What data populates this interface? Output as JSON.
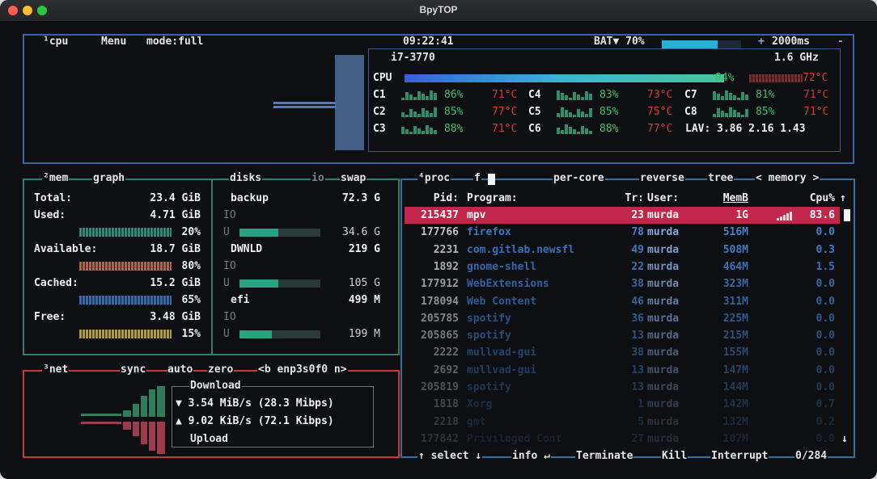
{
  "window": {
    "title": "BpyTOP"
  },
  "cpu": {
    "labels": {
      "cpu": "¹cpu",
      "menu": "Menu",
      "mode": "mode:full",
      "clock": "09:22:41",
      "battery": "BAT▼ 70%",
      "battery_pct": 70,
      "plus": "+",
      "interval": "2000ms",
      "minus": "-"
    },
    "model": "i7-3770",
    "freq": "1.6 GHz",
    "total": {
      "label": "CPU",
      "pct": "84%",
      "pct_value": 84,
      "temp": "72°C"
    },
    "cores": [
      {
        "name": "C1",
        "pct": "86%",
        "temp": "71°C"
      },
      {
        "name": "C2",
        "pct": "85%",
        "temp": "77°C"
      },
      {
        "name": "C3",
        "pct": "88%",
        "temp": "71°C"
      },
      {
        "name": "C4",
        "pct": "83%",
        "temp": "73°C"
      },
      {
        "name": "C5",
        "pct": "85%",
        "temp": "75°C"
      },
      {
        "name": "C6",
        "pct": "88%",
        "temp": "77°C"
      },
      {
        "name": "C7",
        "pct": "81%",
        "temp": "71°C"
      },
      {
        "name": "C8",
        "pct": "85%",
        "temp": "71°C"
      }
    ],
    "lav_label": "LAV:",
    "load_avg": "3.86 2.16 1.43"
  },
  "mem": {
    "labels": {
      "mem": "²mem",
      "graph": "graph"
    },
    "rows": [
      {
        "label": "Total:",
        "value": "23.4 GiB"
      },
      {
        "label": "Used:",
        "value": "4.71 GiB",
        "pct": "20%"
      },
      {
        "label": "Available:",
        "value": "18.7 GiB",
        "pct": "80%"
      },
      {
        "label": "Cached:",
        "value": "15.2 GiB",
        "pct": "65%"
      },
      {
        "label": "Free:",
        "value": "3.48 GiB",
        "pct": "15%"
      }
    ]
  },
  "disks": {
    "labels": {
      "disks": "disks",
      "io": "io",
      "swap": "swap"
    },
    "items": [
      {
        "name": "backup",
        "size": "72.3 G",
        "io": "IO",
        "u": "U",
        "used": "34.6 G",
        "used_pct": 48
      },
      {
        "name": "DWNLD",
        "size": "219 G",
        "io": "IO",
        "u": "U",
        "used": "105 G",
        "used_pct": 48
      },
      {
        "name": "efi",
        "size": "499 M",
        "io": "IO",
        "u": "U",
        "used": "199 M",
        "used_pct": 40
      }
    ]
  },
  "net": {
    "labels": {
      "net": "³net",
      "sync": "sync",
      "auto": "auto",
      "zero": "zero",
      "iface": "<b enp3s0f0 n>"
    },
    "download_label": "Download",
    "download": "▼ 3.54 MiB/s (28.3 Mibps)",
    "upload": "▲ 9.02 KiB/s (72.1 Kibps)",
    "upload_label": "Upload"
  },
  "proc": {
    "labels": {
      "proc": "⁴proc",
      "filter": "f",
      "per_core": "per-core",
      "reverse": "reverse",
      "tree": "tree",
      "sort": "< memory >"
    },
    "columns": {
      "pid": "Pid:",
      "program": "Program:",
      "tr": "Tr:",
      "user": "User:",
      "mem": "MemB",
      "cpu": "Cpu%"
    },
    "rows": [
      {
        "pid": "215437",
        "program": "mpv",
        "tr": "23",
        "user": "murda",
        "mem": "1G",
        "cpu": "83.6"
      },
      {
        "pid": "177766",
        "program": "firefox",
        "tr": "78",
        "user": "murda",
        "mem": "516M",
        "cpu": "0.0"
      },
      {
        "pid": "2231",
        "program": "com.gitlab.newsfl",
        "tr": "49",
        "user": "murda",
        "mem": "508M",
        "cpu": "0.3"
      },
      {
        "pid": "1892",
        "program": "gnome-shell",
        "tr": "22",
        "user": "murda",
        "mem": "464M",
        "cpu": "1.5"
      },
      {
        "pid": "177912",
        "program": "WebExtensions",
        "tr": "38",
        "user": "murda",
        "mem": "323M",
        "cpu": "0.0"
      },
      {
        "pid": "178094",
        "program": "Web Content",
        "tr": "46",
        "user": "murda",
        "mem": "311M",
        "cpu": "0.0"
      },
      {
        "pid": "205785",
        "program": "spotify",
        "tr": "36",
        "user": "murda",
        "mem": "225M",
        "cpu": "0.0"
      },
      {
        "pid": "205865",
        "program": "spotify",
        "tr": "13",
        "user": "murda",
        "mem": "215M",
        "cpu": "0.0"
      },
      {
        "pid": "2222",
        "program": "mullvad-gui",
        "tr": "38",
        "user": "murda",
        "mem": "155M",
        "cpu": "0.0"
      },
      {
        "pid": "2692",
        "program": "mullvad-gui",
        "tr": "13",
        "user": "murda",
        "mem": "147M",
        "cpu": "0.0"
      },
      {
        "pid": "205819",
        "program": "spotify",
        "tr": "13",
        "user": "murda",
        "mem": "144M",
        "cpu": "0.0"
      },
      {
        "pid": "1818",
        "program": "Xorg",
        "tr": "1",
        "user": "murda",
        "mem": "142M",
        "cpu": "0.7"
      },
      {
        "pid": "2218",
        "program": "gmt",
        "tr": "5",
        "user": "murda",
        "mem": "132M",
        "cpu": "0.2"
      },
      {
        "pid": "177842",
        "program": "Privileged Cont",
        "tr": "27",
        "user": "murda",
        "mem": "107M",
        "cpu": "0.0"
      }
    ],
    "footer": {
      "select": "↑ select ↓",
      "info": "info ↵",
      "terminate": "Terminate",
      "kill": "Kill",
      "interrupt": "Interrupt",
      "count": "0/284"
    }
  },
  "colors": {
    "cpu_border": "#3d64a8",
    "mem_border": "#2f7f71",
    "net_border": "#c83a3a",
    "proc_border": "#3b6f9a",
    "selected_row": "#c0274a"
  }
}
